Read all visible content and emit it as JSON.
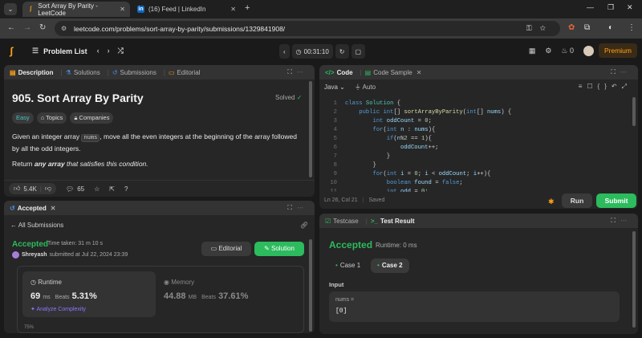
{
  "browser": {
    "tabs": [
      {
        "title": "Sort Array By Parity - LeetCode",
        "active": true
      },
      {
        "title": "(16) Feed | LinkedIn",
        "active": false
      }
    ],
    "url": "leetcode.com/problems/sort-array-by-parity/submissions/1329841908/"
  },
  "nav": {
    "problem_list": "Problem List",
    "timer": "00:31:10",
    "notifications": "0",
    "premium": "Premium"
  },
  "description_panel": {
    "tabs": [
      "Description",
      "Solutions",
      "Submissions",
      "Editorial"
    ],
    "title": "905. Sort Array By Parity",
    "status": "Solved",
    "chips": [
      "Easy",
      "Topics",
      "Companies"
    ],
    "text_before": "Given an integer array ",
    "code_word": "nums",
    "text_after": ", move all the even integers at the beginning of the array followed by all the odd integers.",
    "return_prefix": "Return ",
    "return_em": "any array",
    "return_suffix": " that satisfies this condition.",
    "likes": "5.4K",
    "comments": "65"
  },
  "accepted_panel": {
    "tab": "Accepted",
    "back": "All Submissions",
    "status": "Accepted",
    "time_taken": "Time taken: 31 m 10 s",
    "user": "Shreyash",
    "submitted_at": "submitted at Jul 22, 2024 23:39",
    "editorial_btn": "Editorial",
    "solution_btn": "Solution",
    "runtime_label": "Runtime",
    "runtime_value": "69",
    "runtime_unit": "ms",
    "runtime_beats_label": "Beats",
    "runtime_beats": "5.31%",
    "analyze": "Analyze Complexity",
    "memory_label": "Memory",
    "memory_value": "44.88",
    "memory_unit": "MB",
    "memory_beats_label": "Beats",
    "memory_beats": "37.61%",
    "chart_tick": "75%"
  },
  "code_panel": {
    "tabs": [
      "Code",
      "Code Sample"
    ],
    "language": "Java",
    "mode": "Auto",
    "status_pos": "Ln 26, Col 21",
    "status_saved": "Saved",
    "run": "Run",
    "submit": "Submit"
  },
  "test_panel": {
    "tabs": [
      "Testcase",
      "Test Result"
    ],
    "status": "Accepted",
    "runtime": "Runtime: 0 ms",
    "cases": [
      "Case 1",
      "Case 2"
    ],
    "input_label": "Input",
    "input_var": "nums =",
    "input_value": "[0]"
  },
  "colors": {
    "accent_green": "#2cbb5d",
    "brand_orange": "#ffa116",
    "easy_teal": "#46c6c2"
  }
}
